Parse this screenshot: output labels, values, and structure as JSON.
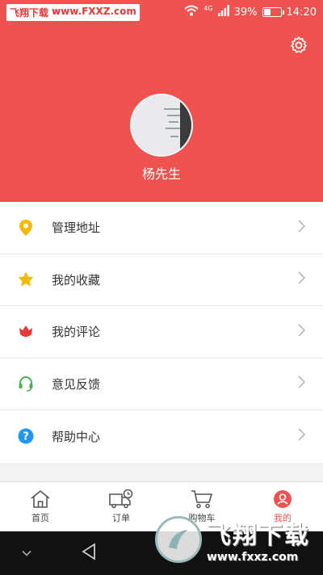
{
  "status_bar": {
    "watermark_cn": "飞翔下载",
    "watermark_url": "www.FXXZ.com",
    "network": "4G",
    "battery": "39%",
    "time": "14:20"
  },
  "profile": {
    "username": "杨先生"
  },
  "menu": [
    {
      "label": "管理地址",
      "icon": "location-pin-icon",
      "color": "#f5b800"
    },
    {
      "label": "我的收藏",
      "icon": "star-icon",
      "color": "#f5b800"
    },
    {
      "label": "我的评论",
      "icon": "tulip-icon",
      "color": "#e53935"
    },
    {
      "label": "意见反馈",
      "icon": "headset-icon",
      "color": "#4caf50"
    },
    {
      "label": "帮助中心",
      "icon": "help-circle-icon",
      "color": "#2196f3"
    }
  ],
  "tabs": [
    {
      "label": "首页",
      "icon": "home-icon"
    },
    {
      "label": "订单",
      "icon": "truck-icon"
    },
    {
      "label": "购物车",
      "icon": "cart-icon"
    },
    {
      "label": "我的",
      "icon": "user-icon",
      "active": true
    }
  ],
  "watermark": {
    "cn": "飞翔下载",
    "url": "www.fxxz.com"
  },
  "colors": {
    "accent": "#ef5350"
  }
}
